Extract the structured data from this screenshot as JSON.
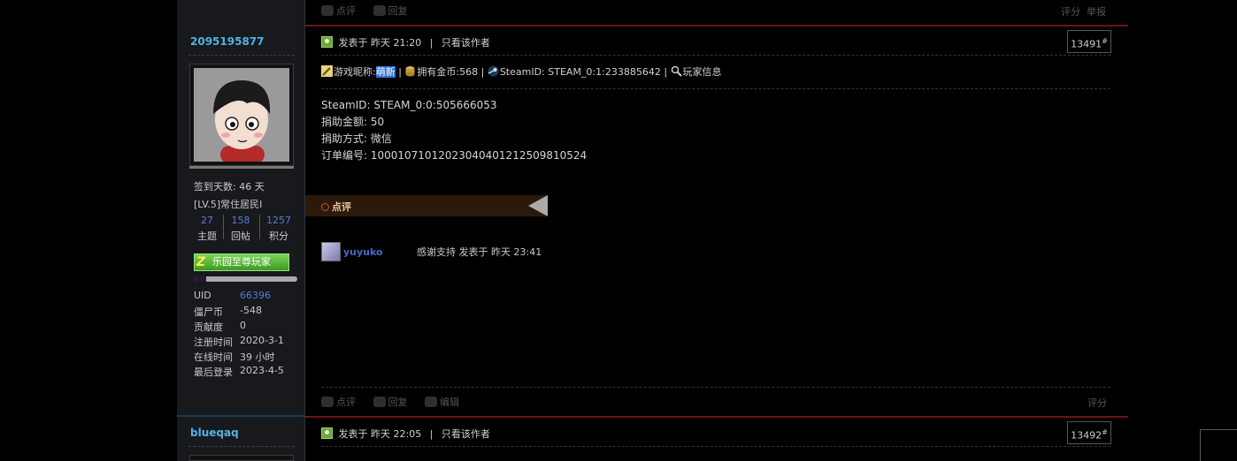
{
  "prev_post": {
    "actions": [
      "点评",
      "回复"
    ],
    "right_links": [
      "评分",
      "举报"
    ]
  },
  "author": {
    "username": "2095195877",
    "checkin": "签到天数: 46 天",
    "level": "[LV.5]常住居民I",
    "stats": [
      {
        "num": "27",
        "label": "主题"
      },
      {
        "num": "158",
        "label": "回帖"
      },
      {
        "num": "1257",
        "label": "积分"
      }
    ],
    "medal": "乐园至尊玩家",
    "medal_glyph": "Z",
    "progress": 0.12,
    "info": [
      {
        "key": "UID",
        "value": "66396",
        "link": true
      },
      {
        "key": "僵尸币",
        "value": "-548",
        "link": false
      },
      {
        "key": "贡献度",
        "value": "0",
        "link": false
      },
      {
        "key": "注册时间",
        "value": "2020-3-1",
        "link": false
      },
      {
        "key": "在线时间",
        "value": "39 小时",
        "link": false
      },
      {
        "key": "最后登录",
        "value": "2023-4-5",
        "link": false
      }
    ]
  },
  "post": {
    "posted": "发表于 昨天 21:20",
    "separator": "|",
    "only_author": "只看该作者",
    "floor": "13491",
    "floor_mark": "#",
    "game_nick_label": "游戏昵称:",
    "game_nick": "萌新",
    "coins": "拥有金币:568",
    "steam_id": "SteamID: STEAM_0:1:233885642",
    "player_info": "玩家信息",
    "content": [
      "SteamID: STEAM_0:0:505666053",
      "捐助金额: 50",
      "捐助方式: 微信",
      "订单编号: 10001071012023040401212509810524"
    ],
    "comment_label": "点评",
    "comment": {
      "user": "yuyuko",
      "text": "感谢支持  发表于 昨天 23:41"
    },
    "actions": [
      "点评",
      "回复",
      "编辑"
    ],
    "rate": "评分"
  },
  "next_post": {
    "username": "blueqaq",
    "posted": "发表于 昨天 22:05",
    "only_author": "只看该作者",
    "floor": "13492",
    "floor_mark": "#"
  },
  "colors": {
    "link_blue": "#4fb3e6",
    "accent_red": "#6d1414",
    "highlight": "#2d6fd4"
  },
  "icons": [
    "online-icon",
    "pencil-icon",
    "coin-icon",
    "steam-icon",
    "magnifier-icon",
    "comment-icon",
    "reply-icon",
    "edit-icon"
  ]
}
